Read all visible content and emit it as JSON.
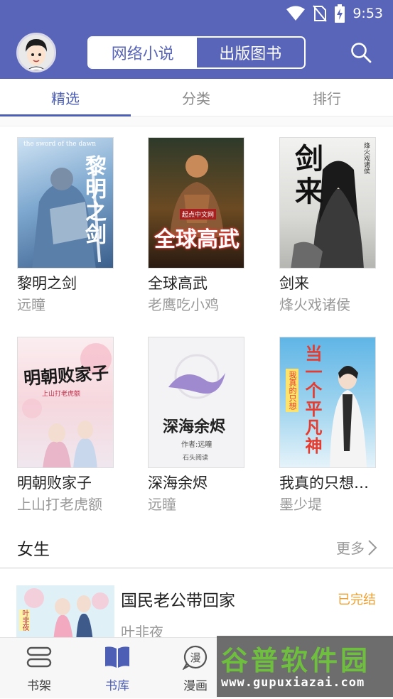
{
  "status_bar": {
    "time": "9:53"
  },
  "header": {
    "segments": [
      {
        "label": "网络小说",
        "active": true
      },
      {
        "label": "出版图书",
        "active": false
      }
    ]
  },
  "tabs": [
    {
      "label": "精选",
      "active": true
    },
    {
      "label": "分类",
      "active": false
    },
    {
      "label": "排行",
      "active": false
    }
  ],
  "books": [
    {
      "title": "黎明之剑",
      "author": "远瞳",
      "cover_text": "黎明之剑",
      "cover_sub": "the sword of the dawn"
    },
    {
      "title": "全球高武",
      "author": "老鹰吃小鸡",
      "cover_text": "全球高武",
      "cover_sub": "起点中文网"
    },
    {
      "title": "剑来",
      "author": "烽火戏诸侯",
      "cover_text": "剑来",
      "cover_sub": "烽火戏诸侯"
    },
    {
      "title": "明朝败家子",
      "author": "上山打老虎额",
      "cover_text": "明朝败家子",
      "cover_sub": "上山打老虎额"
    },
    {
      "title": "深海余烬",
      "author": "远瞳",
      "cover_text": "深海余烬",
      "cover_sub": "作者:远瞳",
      "cover_badge": "石头阅读"
    },
    {
      "title": "我真的只想当一个平凡的普通人",
      "author": "墨少堤",
      "cover_text": "当一个平凡神",
      "cover_sub": "我真的只想"
    }
  ],
  "section": {
    "title": "女生",
    "more": "更多"
  },
  "list_item": {
    "title": "国民老公带回家",
    "author": "叶非夜",
    "status": "已完结",
    "cover_text": "叶非夜"
  },
  "bottom_nav": [
    {
      "label": "书架",
      "icon": "bookshelf-icon",
      "active": false
    },
    {
      "label": "书库",
      "icon": "open-book-icon",
      "active": true
    },
    {
      "label": "漫画",
      "icon": "comic-icon",
      "active": false
    }
  ],
  "watermark": {
    "big": "谷普软件园",
    "small": "www.gupuxiazai.com"
  },
  "colors": {
    "primary": "#5865b8",
    "accent": "#4d5fb5",
    "status_done": "#f0a030"
  }
}
